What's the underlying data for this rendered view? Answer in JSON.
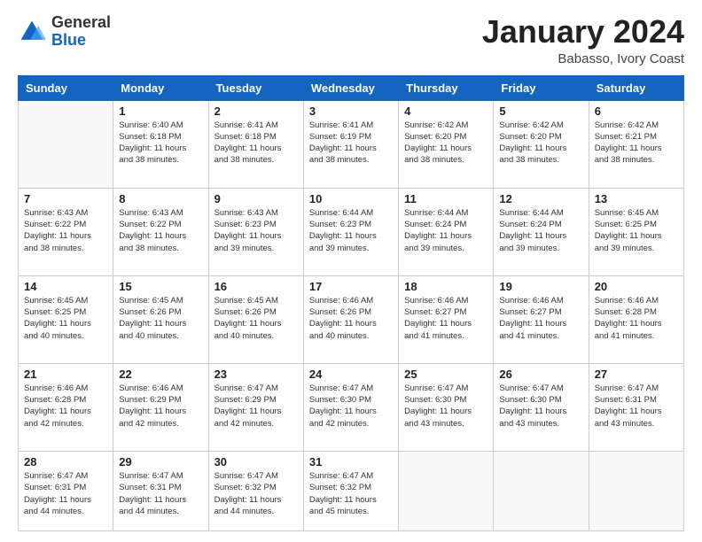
{
  "logo": {
    "general": "General",
    "blue": "Blue"
  },
  "header": {
    "month_year": "January 2024",
    "location": "Babasso, Ivory Coast"
  },
  "weekdays": [
    "Sunday",
    "Monday",
    "Tuesday",
    "Wednesday",
    "Thursday",
    "Friday",
    "Saturday"
  ],
  "weeks": [
    [
      {
        "day": "",
        "sunrise": "",
        "sunset": "",
        "daylight": ""
      },
      {
        "day": "1",
        "sunrise": "Sunrise: 6:40 AM",
        "sunset": "Sunset: 6:18 PM",
        "daylight": "Daylight: 11 hours and 38 minutes."
      },
      {
        "day": "2",
        "sunrise": "Sunrise: 6:41 AM",
        "sunset": "Sunset: 6:18 PM",
        "daylight": "Daylight: 11 hours and 38 minutes."
      },
      {
        "day": "3",
        "sunrise": "Sunrise: 6:41 AM",
        "sunset": "Sunset: 6:19 PM",
        "daylight": "Daylight: 11 hours and 38 minutes."
      },
      {
        "day": "4",
        "sunrise": "Sunrise: 6:42 AM",
        "sunset": "Sunset: 6:20 PM",
        "daylight": "Daylight: 11 hours and 38 minutes."
      },
      {
        "day": "5",
        "sunrise": "Sunrise: 6:42 AM",
        "sunset": "Sunset: 6:20 PM",
        "daylight": "Daylight: 11 hours and 38 minutes."
      },
      {
        "day": "6",
        "sunrise": "Sunrise: 6:42 AM",
        "sunset": "Sunset: 6:21 PM",
        "daylight": "Daylight: 11 hours and 38 minutes."
      }
    ],
    [
      {
        "day": "7",
        "sunrise": "Sunrise: 6:43 AM",
        "sunset": "Sunset: 6:22 PM",
        "daylight": "Daylight: 11 hours and 38 minutes."
      },
      {
        "day": "8",
        "sunrise": "Sunrise: 6:43 AM",
        "sunset": "Sunset: 6:22 PM",
        "daylight": "Daylight: 11 hours and 38 minutes."
      },
      {
        "day": "9",
        "sunrise": "Sunrise: 6:43 AM",
        "sunset": "Sunset: 6:23 PM",
        "daylight": "Daylight: 11 hours and 39 minutes."
      },
      {
        "day": "10",
        "sunrise": "Sunrise: 6:44 AM",
        "sunset": "Sunset: 6:23 PM",
        "daylight": "Daylight: 11 hours and 39 minutes."
      },
      {
        "day": "11",
        "sunrise": "Sunrise: 6:44 AM",
        "sunset": "Sunset: 6:24 PM",
        "daylight": "Daylight: 11 hours and 39 minutes."
      },
      {
        "day": "12",
        "sunrise": "Sunrise: 6:44 AM",
        "sunset": "Sunset: 6:24 PM",
        "daylight": "Daylight: 11 hours and 39 minutes."
      },
      {
        "day": "13",
        "sunrise": "Sunrise: 6:45 AM",
        "sunset": "Sunset: 6:25 PM",
        "daylight": "Daylight: 11 hours and 39 minutes."
      }
    ],
    [
      {
        "day": "14",
        "sunrise": "Sunrise: 6:45 AM",
        "sunset": "Sunset: 6:25 PM",
        "daylight": "Daylight: 11 hours and 40 minutes."
      },
      {
        "day": "15",
        "sunrise": "Sunrise: 6:45 AM",
        "sunset": "Sunset: 6:26 PM",
        "daylight": "Daylight: 11 hours and 40 minutes."
      },
      {
        "day": "16",
        "sunrise": "Sunrise: 6:45 AM",
        "sunset": "Sunset: 6:26 PM",
        "daylight": "Daylight: 11 hours and 40 minutes."
      },
      {
        "day": "17",
        "sunrise": "Sunrise: 6:46 AM",
        "sunset": "Sunset: 6:26 PM",
        "daylight": "Daylight: 11 hours and 40 minutes."
      },
      {
        "day": "18",
        "sunrise": "Sunrise: 6:46 AM",
        "sunset": "Sunset: 6:27 PM",
        "daylight": "Daylight: 11 hours and 41 minutes."
      },
      {
        "day": "19",
        "sunrise": "Sunrise: 6:46 AM",
        "sunset": "Sunset: 6:27 PM",
        "daylight": "Daylight: 11 hours and 41 minutes."
      },
      {
        "day": "20",
        "sunrise": "Sunrise: 6:46 AM",
        "sunset": "Sunset: 6:28 PM",
        "daylight": "Daylight: 11 hours and 41 minutes."
      }
    ],
    [
      {
        "day": "21",
        "sunrise": "Sunrise: 6:46 AM",
        "sunset": "Sunset: 6:28 PM",
        "daylight": "Daylight: 11 hours and 42 minutes."
      },
      {
        "day": "22",
        "sunrise": "Sunrise: 6:46 AM",
        "sunset": "Sunset: 6:29 PM",
        "daylight": "Daylight: 11 hours and 42 minutes."
      },
      {
        "day": "23",
        "sunrise": "Sunrise: 6:47 AM",
        "sunset": "Sunset: 6:29 PM",
        "daylight": "Daylight: 11 hours and 42 minutes."
      },
      {
        "day": "24",
        "sunrise": "Sunrise: 6:47 AM",
        "sunset": "Sunset: 6:30 PM",
        "daylight": "Daylight: 11 hours and 42 minutes."
      },
      {
        "day": "25",
        "sunrise": "Sunrise: 6:47 AM",
        "sunset": "Sunset: 6:30 PM",
        "daylight": "Daylight: 11 hours and 43 minutes."
      },
      {
        "day": "26",
        "sunrise": "Sunrise: 6:47 AM",
        "sunset": "Sunset: 6:30 PM",
        "daylight": "Daylight: 11 hours and 43 minutes."
      },
      {
        "day": "27",
        "sunrise": "Sunrise: 6:47 AM",
        "sunset": "Sunset: 6:31 PM",
        "daylight": "Daylight: 11 hours and 43 minutes."
      }
    ],
    [
      {
        "day": "28",
        "sunrise": "Sunrise: 6:47 AM",
        "sunset": "Sunset: 6:31 PM",
        "daylight": "Daylight: 11 hours and 44 minutes."
      },
      {
        "day": "29",
        "sunrise": "Sunrise: 6:47 AM",
        "sunset": "Sunset: 6:31 PM",
        "daylight": "Daylight: 11 hours and 44 minutes."
      },
      {
        "day": "30",
        "sunrise": "Sunrise: 6:47 AM",
        "sunset": "Sunset: 6:32 PM",
        "daylight": "Daylight: 11 hours and 44 minutes."
      },
      {
        "day": "31",
        "sunrise": "Sunrise: 6:47 AM",
        "sunset": "Sunset: 6:32 PM",
        "daylight": "Daylight: 11 hours and 45 minutes."
      },
      {
        "day": "",
        "sunrise": "",
        "sunset": "",
        "daylight": ""
      },
      {
        "day": "",
        "sunrise": "",
        "sunset": "",
        "daylight": ""
      },
      {
        "day": "",
        "sunrise": "",
        "sunset": "",
        "daylight": ""
      }
    ]
  ]
}
